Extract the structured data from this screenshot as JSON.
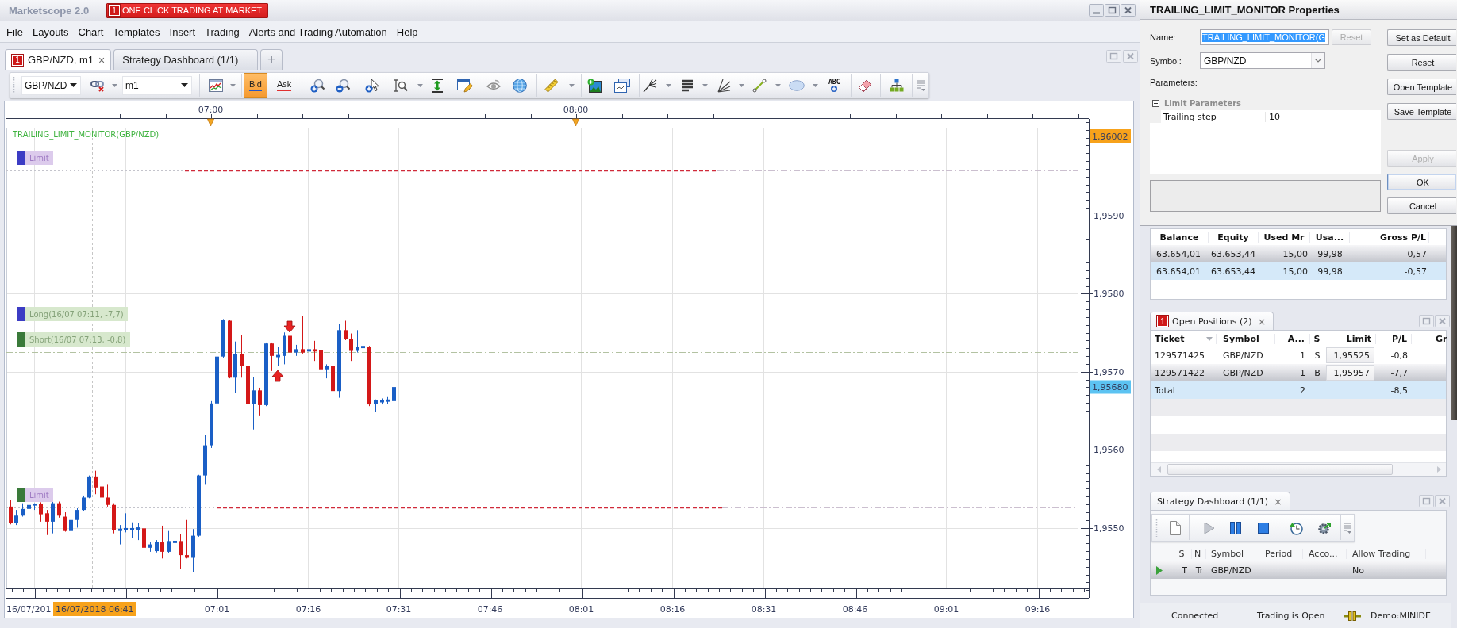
{
  "window": {
    "title": "Marketscope 2.0",
    "trade_button": {
      "badge": "1",
      "label": "ONE CLICK TRADING AT MARKET"
    }
  },
  "menu": [
    "File",
    "Layouts",
    "Chart",
    "Templates",
    "Insert",
    "Trading",
    "Alerts and Trading Automation",
    "Help"
  ],
  "tabs": [
    {
      "badge": "1",
      "label": "GBP/NZD, m1",
      "close": "×",
      "selected": true
    },
    {
      "label": "Strategy Dashboard (1/1)",
      "selected": false
    }
  ],
  "add_tab": "+",
  "toolbar": {
    "symbol": "GBP/NZD",
    "period": "m1",
    "price_modes": [
      {
        "kind": "bid",
        "label": "Bid",
        "selected": true
      },
      {
        "kind": "ask",
        "label": "Ask",
        "selected": false
      }
    ],
    "text_tool": "ABC"
  },
  "chart": {
    "indicator": "TRAILING_LIMIT_MONITOR(GBP/NZD)",
    "top_marks": [
      "07:00",
      "08:00"
    ],
    "markers": [
      {
        "kind": "limit",
        "label": "Limit",
        "color": "#3c3cc4"
      },
      {
        "kind": "position",
        "label": "Long(16/07 07:11, -7,7)",
        "color": "#3c3cc4"
      },
      {
        "kind": "position",
        "label": "Short(16/07 07:13, -0,8)",
        "color": "#3a7a3a"
      },
      {
        "kind": "limit",
        "label": "Limit",
        "color": "#3a7a3a"
      }
    ],
    "price_ticks": [
      "1,9590",
      "1,9580",
      "1,9570",
      "1,9560",
      "1,9550"
    ],
    "price_tags": [
      {
        "label": "1,96002",
        "color": "#f7a21b"
      },
      {
        "label": "1,95680",
        "color": "#5cc3f2"
      }
    ],
    "time_ticks": [
      "07:01",
      "07:16",
      "07:31",
      "07:46",
      "08:01",
      "08:16",
      "08:31",
      "08:46",
      "09:01",
      "09:16"
    ],
    "start_date": "16/07/201",
    "cursor_time": "16/07/2018 06:41"
  },
  "properties": {
    "title": "TRAILING_LIMIT_MONITOR Properties",
    "name_label": "Name:",
    "name_value": "TRAILING_LIMIT_MONITOR(G",
    "name_selected": true,
    "name_reset": {
      "label": "Reset",
      "disabled": true
    },
    "symbol_label": "Symbol:",
    "symbol_value": "GBP/NZD",
    "parameters_label": "Parameters:",
    "groups": [
      {
        "label": "Limit Parameters",
        "expanded": true,
        "rows": [
          {
            "name": "Trailing step",
            "value": "10"
          }
        ]
      }
    ],
    "side_buttons": [
      {
        "label": "Set as Default",
        "disabled": false
      },
      {
        "label": "Reset",
        "disabled": false
      },
      {
        "label": "Open Template",
        "disabled": false
      },
      {
        "label": "Save Template",
        "disabled": false
      }
    ],
    "action_buttons": [
      {
        "label": "Apply",
        "disabled": true,
        "default": false
      },
      {
        "label": "OK",
        "disabled": false,
        "default": true
      },
      {
        "label": "Cancel",
        "disabled": false,
        "default": false
      }
    ]
  },
  "accounts": {
    "columns": [
      "Balance",
      "Equity",
      "Used Mr",
      "Usa...",
      "Gross P/L"
    ],
    "rows": [
      {
        "kind": "account",
        "selected": true,
        "cells": [
          "63.654,01",
          "63.653,44",
          "15,00",
          "99,98",
          "-0,57"
        ]
      },
      {
        "kind": "total",
        "selected": false,
        "cells": [
          "63.654,01",
          "63.653,44",
          "15,00",
          "99,98",
          "-0,57"
        ]
      }
    ]
  },
  "positions": {
    "badge": "1",
    "title": "Open Positions (2)",
    "close": "×",
    "columns": [
      {
        "label": "Ticket",
        "sorted": true
      },
      {
        "label": "Symbol",
        "sorted": false
      },
      {
        "label": "A...",
        "sorted": false
      },
      {
        "label": "S",
        "sorted": false
      },
      {
        "label": "Limit",
        "sorted": false
      },
      {
        "label": "P/L",
        "sorted": false
      },
      {
        "label": "Gr",
        "sorted": false
      }
    ],
    "rows": [
      {
        "kind": "position",
        "selected": false,
        "cells": [
          "129571425",
          "GBP/NZD",
          "1",
          "S",
          "1,95525",
          "-0,8"
        ]
      },
      {
        "kind": "position",
        "selected": true,
        "cells": [
          "129571422",
          "GBP/NZD",
          "1",
          "B",
          "1,95957",
          "-7,7"
        ]
      },
      {
        "kind": "total",
        "selected": false,
        "cells": [
          "Total",
          null,
          "2",
          null,
          null,
          "-8,5"
        ]
      }
    ]
  },
  "strategy_dashboard": {
    "title": "Strategy Dashboard (1/1)",
    "close": "×",
    "columns": [
      "S",
      "N",
      "Symbol",
      "Period",
      "Acco...",
      "Allow Trading"
    ],
    "rows": [
      {
        "running": true,
        "selected": true,
        "cells": [
          "T",
          "Tr",
          "GBP/NZD",
          null,
          null,
          "No"
        ]
      }
    ]
  },
  "status_bar": {
    "connection": "Connected",
    "trading": "Trading is Open",
    "account": "Demo:MINIDE"
  }
}
